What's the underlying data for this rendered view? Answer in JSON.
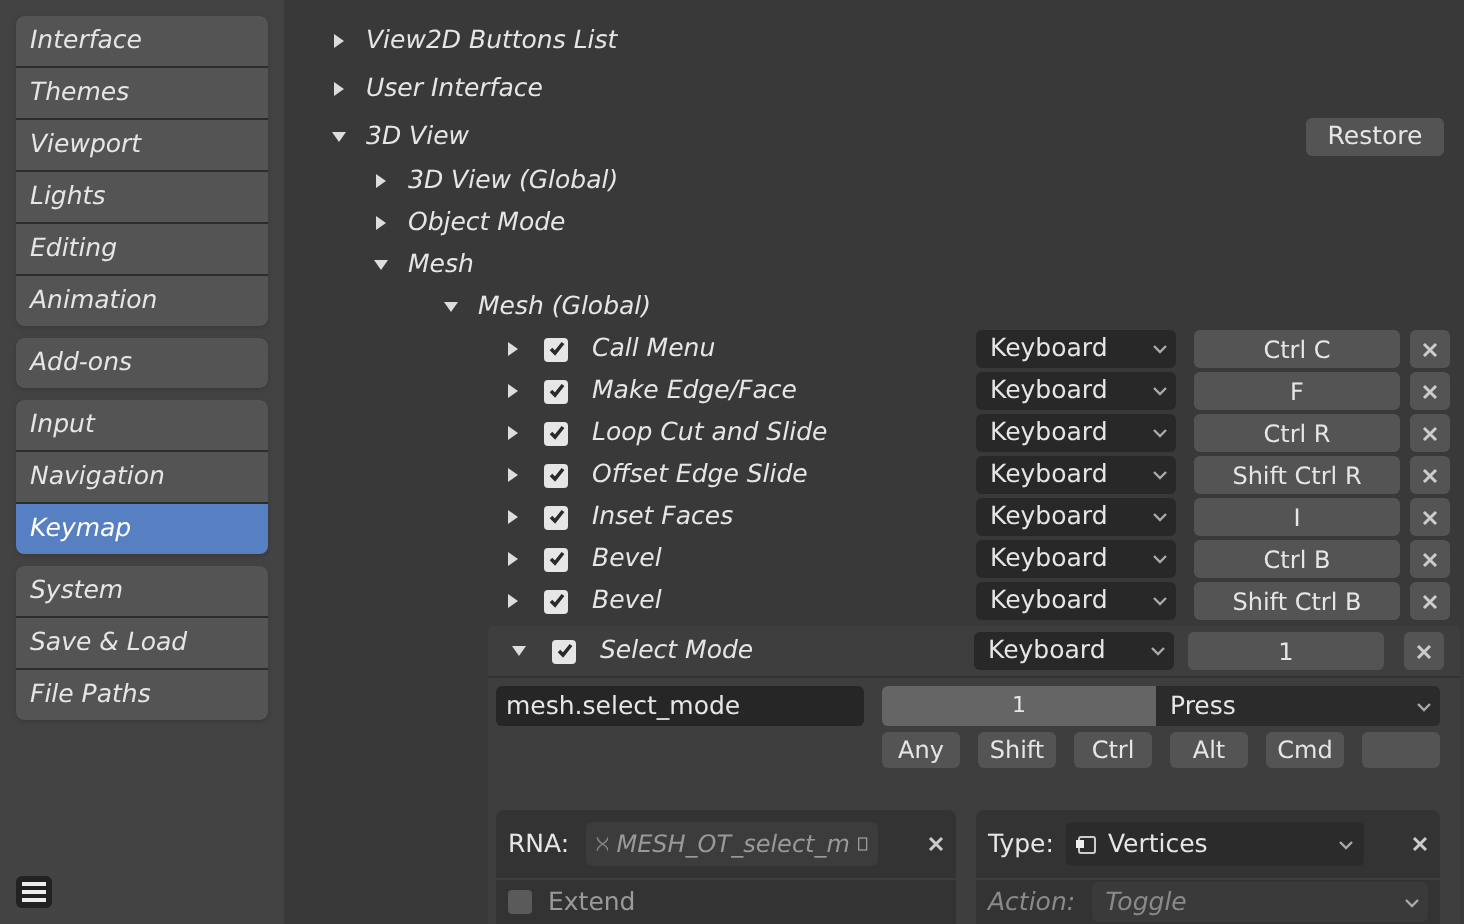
{
  "sidebar": {
    "groups": [
      [
        {
          "label": "Interface",
          "selected": false
        },
        {
          "label": "Themes",
          "selected": false
        },
        {
          "label": "Viewport",
          "selected": false
        },
        {
          "label": "Lights",
          "selected": false
        },
        {
          "label": "Editing",
          "selected": false
        },
        {
          "label": "Animation",
          "selected": false
        }
      ],
      [
        {
          "label": "Add-ons",
          "selected": false
        }
      ],
      [
        {
          "label": "Input",
          "selected": false
        },
        {
          "label": "Navigation",
          "selected": false
        },
        {
          "label": "Keymap",
          "selected": true
        }
      ],
      [
        {
          "label": "System",
          "selected": false
        },
        {
          "label": "Save & Load",
          "selected": false
        },
        {
          "label": "File Paths",
          "selected": false
        }
      ]
    ]
  },
  "tree": [
    {
      "kind": "category",
      "label": "View2D Buttons List",
      "expanded": false
    },
    {
      "kind": "category",
      "label": "User Interface",
      "expanded": false
    },
    {
      "kind": "category",
      "label": "3D View",
      "expanded": true,
      "restore_button": "Restore",
      "children": [
        {
          "kind": "category",
          "label": "3D View (Global)",
          "expanded": false
        },
        {
          "kind": "category",
          "label": "Object Mode",
          "expanded": false
        },
        {
          "kind": "category",
          "label": "Mesh",
          "expanded": true,
          "children": [
            {
              "kind": "category",
              "label": "Mesh (Global)",
              "expanded": true,
              "children": [
                {
                  "kind": "keymap_item",
                  "label": "Call Menu",
                  "expanded": false,
                  "enabled": true,
                  "input_type": "Keyboard",
                  "key": "Ctrl C"
                },
                {
                  "kind": "keymap_item",
                  "label": "Make Edge/Face",
                  "expanded": false,
                  "enabled": true,
                  "input_type": "Keyboard",
                  "key": "F"
                },
                {
                  "kind": "keymap_item",
                  "label": "Loop Cut and Slide",
                  "expanded": false,
                  "enabled": true,
                  "input_type": "Keyboard",
                  "key": "Ctrl R"
                },
                {
                  "kind": "keymap_item",
                  "label": "Offset Edge Slide",
                  "expanded": false,
                  "enabled": true,
                  "input_type": "Keyboard",
                  "key": "Shift Ctrl R"
                },
                {
                  "kind": "keymap_item",
                  "label": "Inset Faces",
                  "expanded": false,
                  "enabled": true,
                  "input_type": "Keyboard",
                  "key": "I"
                },
                {
                  "kind": "keymap_item",
                  "label": "Bevel",
                  "expanded": false,
                  "enabled": true,
                  "input_type": "Keyboard",
                  "key": "Ctrl B"
                },
                {
                  "kind": "keymap_item",
                  "label": "Bevel",
                  "expanded": false,
                  "enabled": true,
                  "input_type": "Keyboard",
                  "key": "Shift Ctrl B"
                },
                {
                  "kind": "keymap_item",
                  "label": "Select Mode",
                  "expanded": true,
                  "enabled": true,
                  "input_type": "Keyboard",
                  "key": "1",
                  "details": {
                    "operator": "mesh.select_mode",
                    "key": "1",
                    "event": "Press",
                    "modifiers": [
                      {
                        "label": "Any",
                        "on": false
                      },
                      {
                        "label": "Shift",
                        "on": false
                      },
                      {
                        "label": "Ctrl",
                        "on": false
                      },
                      {
                        "label": "Alt",
                        "on": false
                      },
                      {
                        "label": "Cmd",
                        "on": false
                      }
                    ],
                    "rna": {
                      "label": "RNA:",
                      "value": "MESH_OT_select_m"
                    },
                    "type": {
                      "label": "Type:",
                      "value": "Vertices"
                    },
                    "extend": {
                      "label": "Extend",
                      "checked": false
                    },
                    "action": {
                      "label": "Action:",
                      "value": "Toggle"
                    }
                  }
                }
              ]
            }
          ]
        }
      ]
    }
  ]
}
